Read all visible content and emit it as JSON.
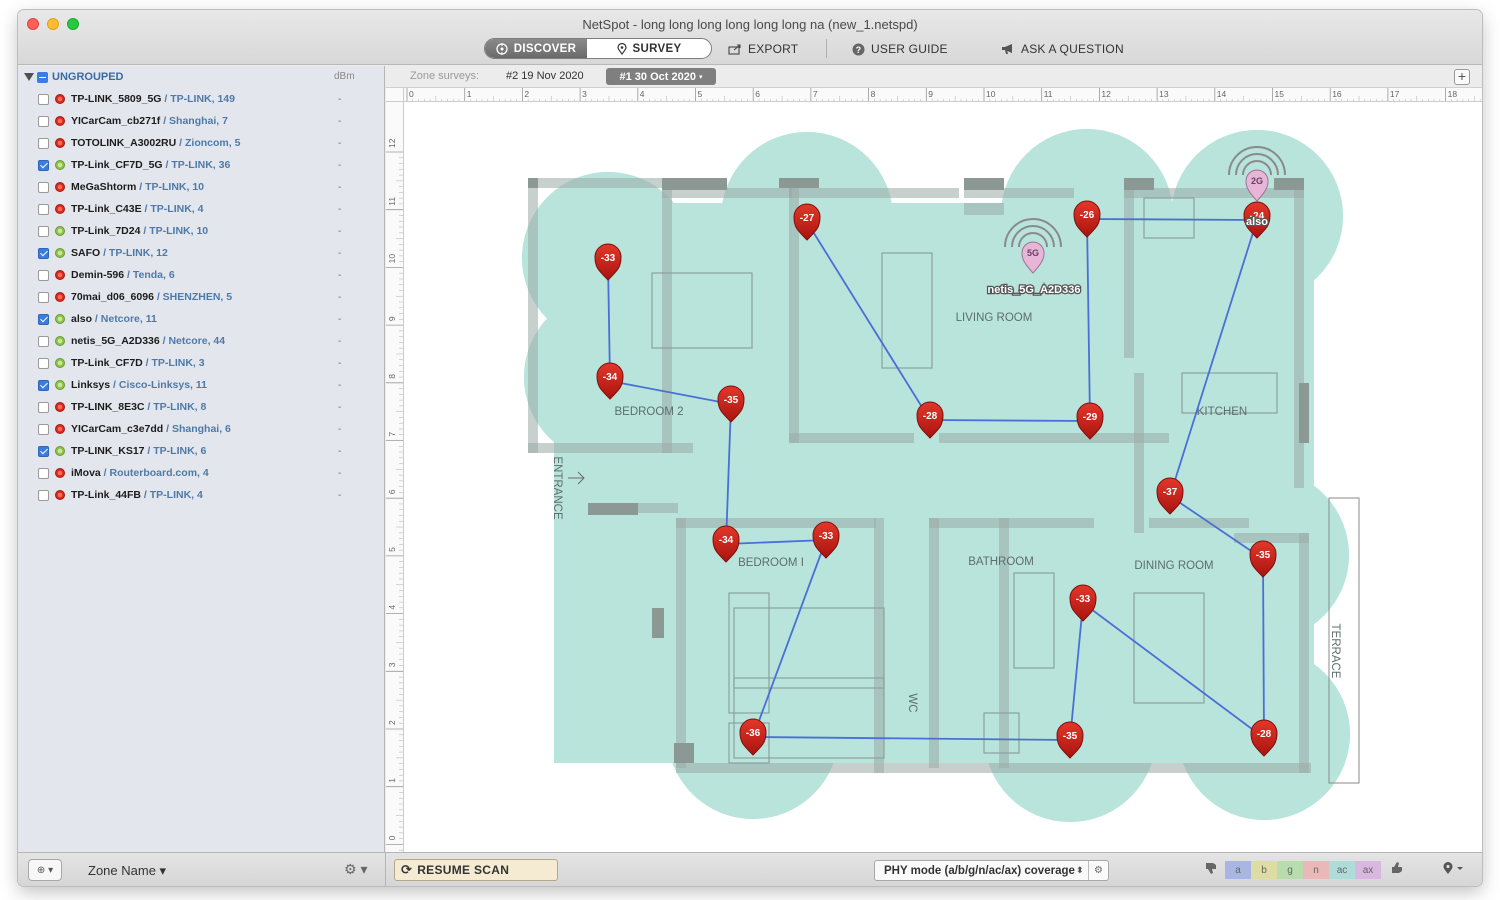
{
  "window": {
    "title": "NetSpot - long long long long long long na (new_1.netspd)"
  },
  "toolbar": {
    "discover_label": "DISCOVER",
    "survey_label": "SURVEY",
    "export_label": "EXPORT",
    "user_guide_label": "USER GUIDE",
    "ask_label": "ASK A QUESTION"
  },
  "sidebar": {
    "group_label": "UNGROUPED",
    "dbm_label": "dBm",
    "networks": [
      {
        "name": "TP-LINK_5809_5G",
        "vendor": " / TP-LINK, 149",
        "checked": false,
        "status": "red",
        "dbm": "-"
      },
      {
        "name": "YICarCam_cb271f",
        "vendor": " / Shanghai, 7",
        "checked": false,
        "status": "red",
        "dbm": "-"
      },
      {
        "name": "TOTOLINK_A3002RU",
        "vendor": " / Zioncom, 5",
        "checked": false,
        "status": "red",
        "dbm": "-"
      },
      {
        "name": "TP-Link_CF7D_5G",
        "vendor": " / TP-LINK, 36",
        "checked": true,
        "status": "green",
        "dbm": "-"
      },
      {
        "name": "MeGaShtorm",
        "vendor": " / TP-LINK, 10",
        "checked": false,
        "status": "red",
        "dbm": "-"
      },
      {
        "name": "TP-Link_C43E",
        "vendor": " / TP-LINK, 4",
        "checked": false,
        "status": "red",
        "dbm": "-"
      },
      {
        "name": "TP-Link_7D24",
        "vendor": " / TP-LINK, 10",
        "checked": false,
        "status": "green",
        "dbm": "-"
      },
      {
        "name": "SAFO",
        "vendor": " / TP-LINK, 12",
        "checked": true,
        "status": "green",
        "dbm": "-"
      },
      {
        "name": "Demin-596",
        "vendor": " / Tenda, 6",
        "checked": false,
        "status": "red",
        "dbm": "-"
      },
      {
        "name": "70mai_d06_6096",
        "vendor": " / SHENZHEN, 5",
        "checked": false,
        "status": "red",
        "dbm": "-"
      },
      {
        "name": "also",
        "vendor": " / Netcore, 11",
        "checked": true,
        "status": "green",
        "dbm": "-"
      },
      {
        "name": "netis_5G_A2D336",
        "vendor": " / Netcore, 44",
        "checked": false,
        "status": "green",
        "dbm": "-"
      },
      {
        "name": "TP-Link_CF7D",
        "vendor": " / TP-LINK, 3",
        "checked": false,
        "status": "green",
        "dbm": "-"
      },
      {
        "name": "Linksys",
        "vendor": " / Cisco-Linksys, 11",
        "checked": true,
        "status": "green",
        "dbm": "-"
      },
      {
        "name": "TP-LINK_8E3C",
        "vendor": " / TP-LINK, 8",
        "checked": false,
        "status": "red",
        "dbm": "-"
      },
      {
        "name": "YICarCam_c3e7dd",
        "vendor": " / Shanghai, 6",
        "checked": false,
        "status": "red",
        "dbm": "-"
      },
      {
        "name": "TP-LINK_KS17",
        "vendor": " / TP-LINK, 6",
        "checked": true,
        "status": "green",
        "dbm": "-"
      },
      {
        "name": "iMova",
        "vendor": " / Routerboard.com, 4",
        "checked": false,
        "status": "red",
        "dbm": "-"
      },
      {
        "name": "TP-Link_44FB",
        "vendor": " / TP-LINK, 4",
        "checked": false,
        "status": "red",
        "dbm": "-"
      }
    ]
  },
  "zone_surveys": {
    "label": "Zone surveys:",
    "tabs": [
      "#2 19 Nov 2020",
      "#1 30 Oct 2020"
    ],
    "active_tab": "#1 30 Oct 2020",
    "add_label": "+"
  },
  "ruler": {
    "top_ticks": [
      "0",
      "1",
      "2",
      "3",
      "4",
      "5",
      "6",
      "7",
      "8",
      "9",
      "10",
      "11",
      "12",
      "13",
      "14",
      "15",
      "16",
      "17",
      "18"
    ],
    "left_ticks": [
      "12",
      "11",
      "10",
      "9",
      "8",
      "7",
      "6",
      "5",
      "4",
      "3",
      "2",
      "1",
      "0"
    ]
  },
  "floorplan": {
    "rooms": [
      "LIVING ROOM",
      "BEDROOM 2",
      "KITCHEN",
      "ENTRANCE",
      "BEDROOM I",
      "BATHROOM",
      "DINING ROOM",
      "WC",
      "TERRACE"
    ],
    "measurements": [
      "-33",
      "-34",
      "-35",
      "-27",
      "-28",
      "-29",
      "-26",
      "-24",
      "-37",
      "-35",
      "-34",
      "-33",
      "-33",
      "-36",
      "-35",
      "-28"
    ],
    "access_points": [
      {
        "band": "5G",
        "name": "netis_5G_A2D336"
      },
      {
        "band": "2G",
        "name": "also"
      }
    ]
  },
  "bottombar": {
    "add_label": "⊕ ▾",
    "zone_name_label": "Zone Name ▾",
    "gear_label": "⚙ ▾",
    "resume_label": "RESUME SCAN",
    "phy_mode_label": "PHY mode (a/b/g/n/ac/ax) coverage",
    "modes": [
      {
        "label": "a",
        "color": "#a9b6e4"
      },
      {
        "label": "b",
        "color": "#dcdca3"
      },
      {
        "label": "g",
        "color": "#b8dcae"
      },
      {
        "label": "n",
        "color": "#eab8b8"
      },
      {
        "label": "ac",
        "color": "#aeddd9"
      },
      {
        "label": "ax",
        "color": "#d9b7e0"
      }
    ]
  },
  "colors": {
    "coverage": "#b8e4dc",
    "marker": "#c4201a",
    "path": "#4b6fd6"
  }
}
